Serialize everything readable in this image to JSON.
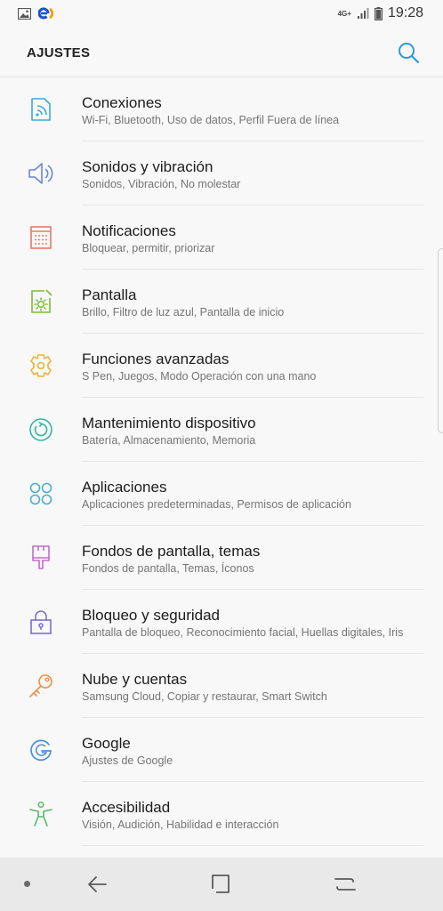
{
  "status_bar": {
    "time": "19:28",
    "network": "4G+",
    "colors": {
      "carrier_blue": "#1a4fd6",
      "carrier_orange": "#f5a300"
    }
  },
  "header": {
    "title": "AJUSTES",
    "search_icon": "search-icon",
    "accent": "#2f9ad6"
  },
  "settings": [
    {
      "title": "Conexiones",
      "subtitle": "Wi-Fi, Bluetooth, Uso de datos, Perfil Fuera de línea",
      "icon": "connections-icon",
      "color": "#3da8d8"
    },
    {
      "title": "Sonidos y vibración",
      "subtitle": "Sonidos, Vibración, No molestar",
      "icon": "sound-icon",
      "color": "#6b86d6"
    },
    {
      "title": "Notificaciones",
      "subtitle": "Bloquear, permitir, priorizar",
      "icon": "notifications-icon",
      "color": "#e8786a"
    },
    {
      "title": "Pantalla",
      "subtitle": "Brillo, Filtro de luz azul, Pantalla de inicio",
      "icon": "display-icon",
      "color": "#7dba3c"
    },
    {
      "title": "Funciones avanzadas",
      "subtitle": "S Pen, Juegos, Modo Operación con una mano",
      "icon": "advanced-features-icon",
      "color": "#f0b335"
    },
    {
      "title": "Mantenimiento dispositivo",
      "subtitle": "Batería, Almacenamiento, Memoria",
      "icon": "device-maintenance-icon",
      "color": "#35b5a0"
    },
    {
      "title": "Aplicaciones",
      "subtitle": "Aplicaciones predeterminadas, Permisos de aplicación",
      "icon": "apps-icon",
      "color": "#4ab0c8"
    },
    {
      "title": "Fondos de pantalla, temas",
      "subtitle": "Fondos de pantalla, Temas, Íconos",
      "icon": "wallpaper-icon",
      "color": "#c56ad0"
    },
    {
      "title": "Bloqueo y seguridad",
      "subtitle": "Pantalla de bloqueo, Reconocimiento facial, Huellas digitales, Iris",
      "icon": "lock-icon",
      "color": "#7d6fd0"
    },
    {
      "title": "Nube y cuentas",
      "subtitle": "Samsung Cloud, Copiar y restaurar, Smart Switch",
      "icon": "key-icon",
      "color": "#ef8f48"
    },
    {
      "title": "Google",
      "subtitle": "Ajustes de Google",
      "icon": "google-icon",
      "color": "#4e8fd8"
    },
    {
      "title": "Accesibilidad",
      "subtitle": "Visión, Audición, Habilidad e interacción",
      "icon": "accessibility-icon",
      "color": "#58b86a"
    }
  ],
  "nav_bar": {
    "buttons": [
      "back-icon",
      "home-icon",
      "recents-icon"
    ]
  }
}
